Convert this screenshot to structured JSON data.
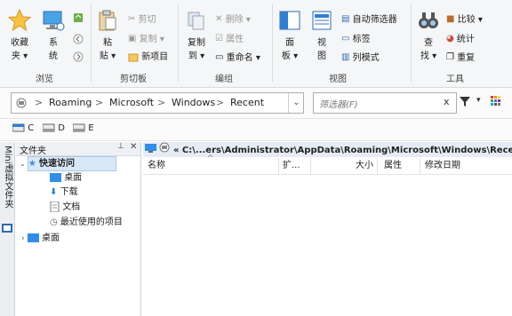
{
  "ribbon": {
    "groups": {
      "browse": "浏览",
      "clipboard": "剪切板",
      "edit": "编组",
      "view": "视图",
      "tools": "工具"
    },
    "favorites": [
      "收藏",
      "夹"
    ],
    "system": [
      "系",
      "统"
    ],
    "paste": [
      "粘",
      "贴"
    ],
    "cut": "剪切",
    "copy_path": "复制",
    "new_item": "新项目",
    "copy_to": [
      "复制",
      "到"
    ],
    "delete": "删除",
    "properties": "属性",
    "rename": "重命名",
    "panel": [
      "面",
      "板"
    ],
    "view": [
      "视",
      "图"
    ],
    "auto_filter": "自动筛选器",
    "tag": "标签",
    "columns": "列模式",
    "find": [
      "查",
      "找"
    ],
    "compare": "比较",
    "stats": "统计",
    "duplicate": "重复"
  },
  "address": {
    "crumbs": [
      "Roaming",
      "Microsoft",
      "Windows",
      "Recent"
    ],
    "sep": ">",
    "filter_placeholder": "筛选器(F)",
    "clear": "x"
  },
  "drives": [
    "C",
    "D",
    "E"
  ],
  "side_tab": "Mini虚拟文件夹",
  "tree": {
    "header": "文件夹",
    "quick_access": "快速访问",
    "items": [
      "桌面",
      "下载",
      "文档",
      "最近使用的项目"
    ],
    "desktop": "桌面"
  },
  "path": "« C:\\...ers\\Administrator\\AppData\\Roaming\\Microsoft\\Windows\\Recent",
  "columns": {
    "name": "名称",
    "ext": "扩...",
    "size": "大小",
    "attr": "属性",
    "modified": "修改日期"
  }
}
